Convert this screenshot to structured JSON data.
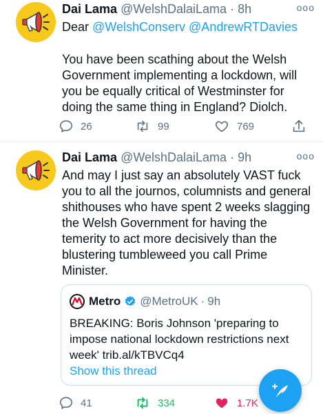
{
  "tweets": [
    {
      "author_name": "Dai Lama",
      "handle": "@WelshDalaiLama",
      "separator": "·",
      "time": "8h",
      "more_glyph": "ooo",
      "reply_prefix": "Dear",
      "reply_mentions": [
        "@WelshConserv",
        "@AndrewRTDavies"
      ],
      "text": "You have been scathing about the Welsh Government implementing a lockdown, will you be equally critical of Westminster for doing the same thing in England? Diolch.",
      "replies": "26",
      "retweets": "99",
      "likes": "769",
      "avatar_icon": "megaphone-icon"
    },
    {
      "author_name": "Dai Lama",
      "handle": "@WelshDalaiLama",
      "separator": "·",
      "time": "9h",
      "more_glyph": "ooo",
      "text": "And may I just say an absolutely VAST fuck you to all the journos, columnists and general shithouses who have spent 2 weeks slagging the Welsh Government for having the temerity to act more decisively than the blustering tumbleweed you call Prime Minister.",
      "replies": "41",
      "retweets": "334",
      "likes": "1.7K",
      "retweeted": true,
      "liked": true,
      "avatar_icon": "megaphone-icon",
      "quote": {
        "author_name": "Metro",
        "verified": true,
        "handle": "@MetroUK",
        "separator": "·",
        "time": "9h",
        "text": "BREAKING: Boris Johnson 'preparing to impose national lockdown restrictions next week' trib.al/kTBVCq4",
        "show_thread": "Show this thread"
      }
    }
  ],
  "compose_button_icon": "feather-plus-icon",
  "colors": {
    "accent": "#1da1f2",
    "retweet_active": "#17bf63",
    "like_active": "#e0245e",
    "secondary_text": "#5b7083",
    "avatar_bg": "#f6c91c"
  }
}
